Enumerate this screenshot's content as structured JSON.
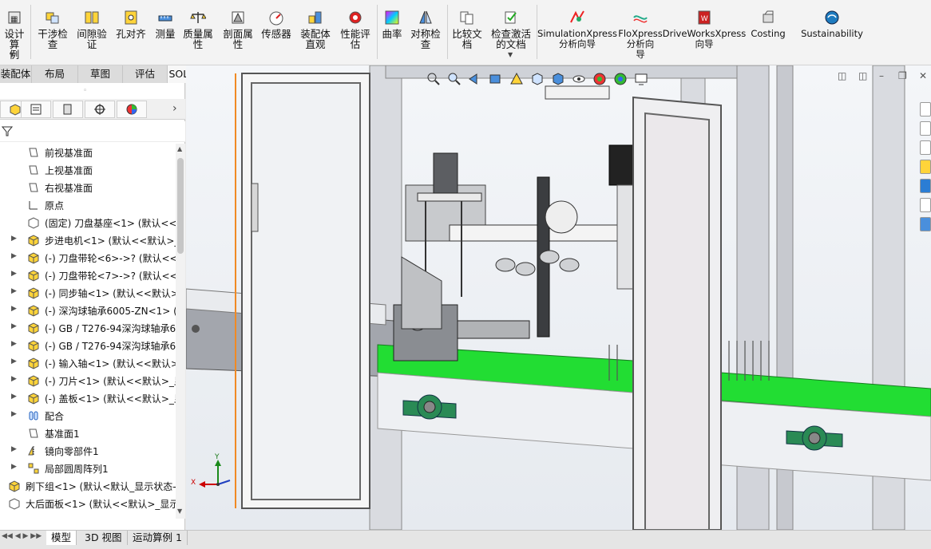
{
  "ribbon": {
    "buttons": [
      {
        "label": "设计算\n例",
        "icon": "design-study-icon"
      },
      {
        "label": "干涉检\n查",
        "icon": "interference-check-icon"
      },
      {
        "label": "间隙验\n证",
        "icon": "clearance-verification-icon"
      },
      {
        "label": "孔对齐",
        "icon": "hole-alignment-icon"
      },
      {
        "label": "测量",
        "icon": "measure-icon"
      },
      {
        "label": "质量属\n性",
        "icon": "mass-properties-icon"
      },
      {
        "label": "剖面属\n性",
        "icon": "section-properties-icon"
      },
      {
        "label": "传感器",
        "icon": "sensor-icon"
      },
      {
        "label": "装配体\n直观",
        "icon": "assembly-visualization-icon"
      },
      {
        "label": "性能评\n估",
        "icon": "performance-evaluation-icon"
      },
      {
        "label": "曲率",
        "icon": "curvature-icon"
      },
      {
        "label": "对称检\n查",
        "icon": "symmetry-check-icon"
      },
      {
        "label": "比较文\n档",
        "icon": "compare-documents-icon"
      },
      {
        "label": "检查激活\n的文档",
        "icon": "check-active-document-icon"
      },
      {
        "label": "SimulationXpress\n分析向导",
        "icon": "simulationxpress-icon"
      },
      {
        "label": "FloXpress\n分析向\n导",
        "icon": "floxpress-icon"
      },
      {
        "label": "DriveWorksXpress\n向导",
        "icon": "driveworksxpress-icon"
      },
      {
        "label": "Costing",
        "icon": "costing-icon"
      },
      {
        "label": "Sustainability",
        "icon": "sustainability-icon"
      }
    ]
  },
  "tabs": [
    "装配体",
    "布局",
    "草图",
    "评估",
    "SOLIDWORKS 插件"
  ],
  "active_tab": "评估",
  "tree": {
    "items": [
      {
        "label": "前视基准面",
        "icon": "plane-icon",
        "expandable": false
      },
      {
        "label": "上视基准面",
        "icon": "plane-icon",
        "expandable": false
      },
      {
        "label": "右视基准面",
        "icon": "plane-icon",
        "expandable": false
      },
      {
        "label": "原点",
        "icon": "origin-icon",
        "expandable": false
      },
      {
        "label": "(固定) 刀盘基座<1> (默认<<",
        "icon": "part-icon",
        "expandable": false
      },
      {
        "label": "步进电机<1> (默认<<默认>_",
        "icon": "subassembly-icon",
        "expandable": true
      },
      {
        "label": "(-) 刀盘带轮<6>->? (默认<<",
        "icon": "subassembly-icon",
        "expandable": true
      },
      {
        "label": "(-) 刀盘带轮<7>->? (默认<<",
        "icon": "subassembly-icon",
        "expandable": true
      },
      {
        "label": "(-) 同步轴<1> (默认<<默认>",
        "icon": "subassembly-icon",
        "expandable": true
      },
      {
        "label": "(-) 深沟球轴承6005-ZN<1> (",
        "icon": "subassembly-icon",
        "expandable": true
      },
      {
        "label": "(-) GB / T276-94深沟球轴承6",
        "icon": "subassembly-icon",
        "expandable": true
      },
      {
        "label": "(-) GB / T276-94深沟球轴承6",
        "icon": "subassembly-icon",
        "expandable": true
      },
      {
        "label": "(-) 输入轴<1> (默认<<默认>",
        "icon": "subassembly-icon",
        "expandable": true
      },
      {
        "label": "(-) 刀片<1> (默认<<默认>_显",
        "icon": "subassembly-icon",
        "expandable": true
      },
      {
        "label": "(-) 盖板<1> (默认<<默认>_显",
        "icon": "subassembly-icon",
        "expandable": true
      },
      {
        "label": "配合",
        "icon": "mates-icon",
        "expandable": true
      },
      {
        "label": "基准面1",
        "icon": "plane-icon",
        "expandable": false
      },
      {
        "label": "镜向零部件1",
        "icon": "mirror-icon",
        "expandable": true
      },
      {
        "label": "局部圆周阵列1",
        "icon": "pattern-icon",
        "expandable": true
      },
      {
        "label": "刷下组<1> (默认<默认_显示状态-",
        "icon": "subassembly-icon",
        "expandable": false,
        "level": 0
      },
      {
        "label": "大后面板<1> (默认<<默认>_显示",
        "icon": "part-icon",
        "expandable": false,
        "level": 0
      }
    ]
  },
  "bottom_tabs": [
    "模型",
    "3D 视图",
    "运动算例 1"
  ],
  "active_bottom_tab": "模型",
  "colors": {
    "accent_green": "#22dd33",
    "frame_orange": "#f08a24",
    "axis_x": "#cc0000",
    "axis_y": "#1a8a1a"
  },
  "triad": {
    "x_label": "X",
    "y_label": "Y"
  }
}
